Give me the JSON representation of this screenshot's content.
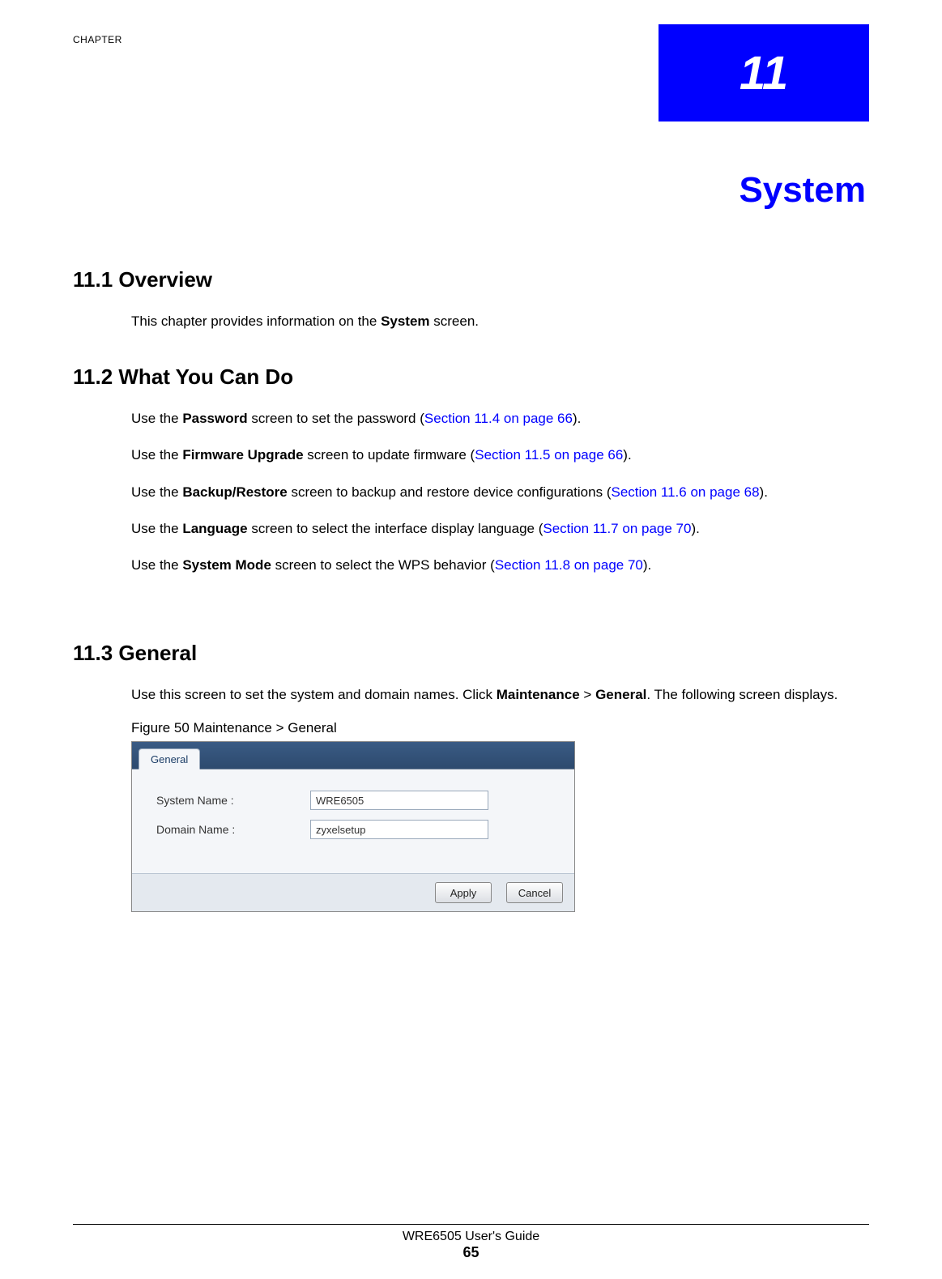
{
  "chapter": {
    "label": "CHAPTER",
    "number": "11",
    "title": "System"
  },
  "sections": {
    "s11_1": {
      "heading": "11.1  Overview",
      "p1a": "This chapter provides information on the ",
      "p1b": "System",
      "p1c": " screen."
    },
    "s11_2": {
      "heading": "11.2  What You Can Do",
      "items": [
        {
          "pre": "Use the ",
          "bold": "Password",
          "mid": " screen to set the password (",
          "xref": "Section 11.4 on page 66",
          "post": ")."
        },
        {
          "pre": "Use the ",
          "bold": "Firmware Upgrade",
          "mid": " screen to update firmware (",
          "xref": "Section 11.5 on page 66",
          "post": ")."
        },
        {
          "pre": "Use the ",
          "bold": "Backup/Restore",
          "mid": " screen to backup and restore device configurations (",
          "xref": "Section 11.6 on page 68",
          "post": ")."
        },
        {
          "pre": "Use the ",
          "bold": "Language",
          "mid": " screen to select the interface display language (",
          "xref": "Section 11.7 on page 70",
          "post": ")."
        },
        {
          "pre": "Use the ",
          "bold": "System Mode",
          "mid": " screen to select the WPS behavior (",
          "xref": "Section 11.8 on page 70",
          "post": ")."
        }
      ]
    },
    "s11_3": {
      "heading": "11.3  General",
      "p1a": "Use this screen to set the system and domain names. Click ",
      "p1b": "Maintenance",
      "p1c": " > ",
      "p1d": "General",
      "p1e": ". The following screen displays.",
      "figure_caption": "Figure 50   Maintenance > General"
    }
  },
  "ui": {
    "tab": "General",
    "rows": [
      {
        "label": "System Name :",
        "value": "WRE6505"
      },
      {
        "label": "Domain Name :",
        "value": "zyxelsetup"
      }
    ],
    "buttons": {
      "apply": "Apply",
      "cancel": "Cancel"
    }
  },
  "footer": {
    "title": "WRE6505 User's Guide",
    "page": "65"
  }
}
